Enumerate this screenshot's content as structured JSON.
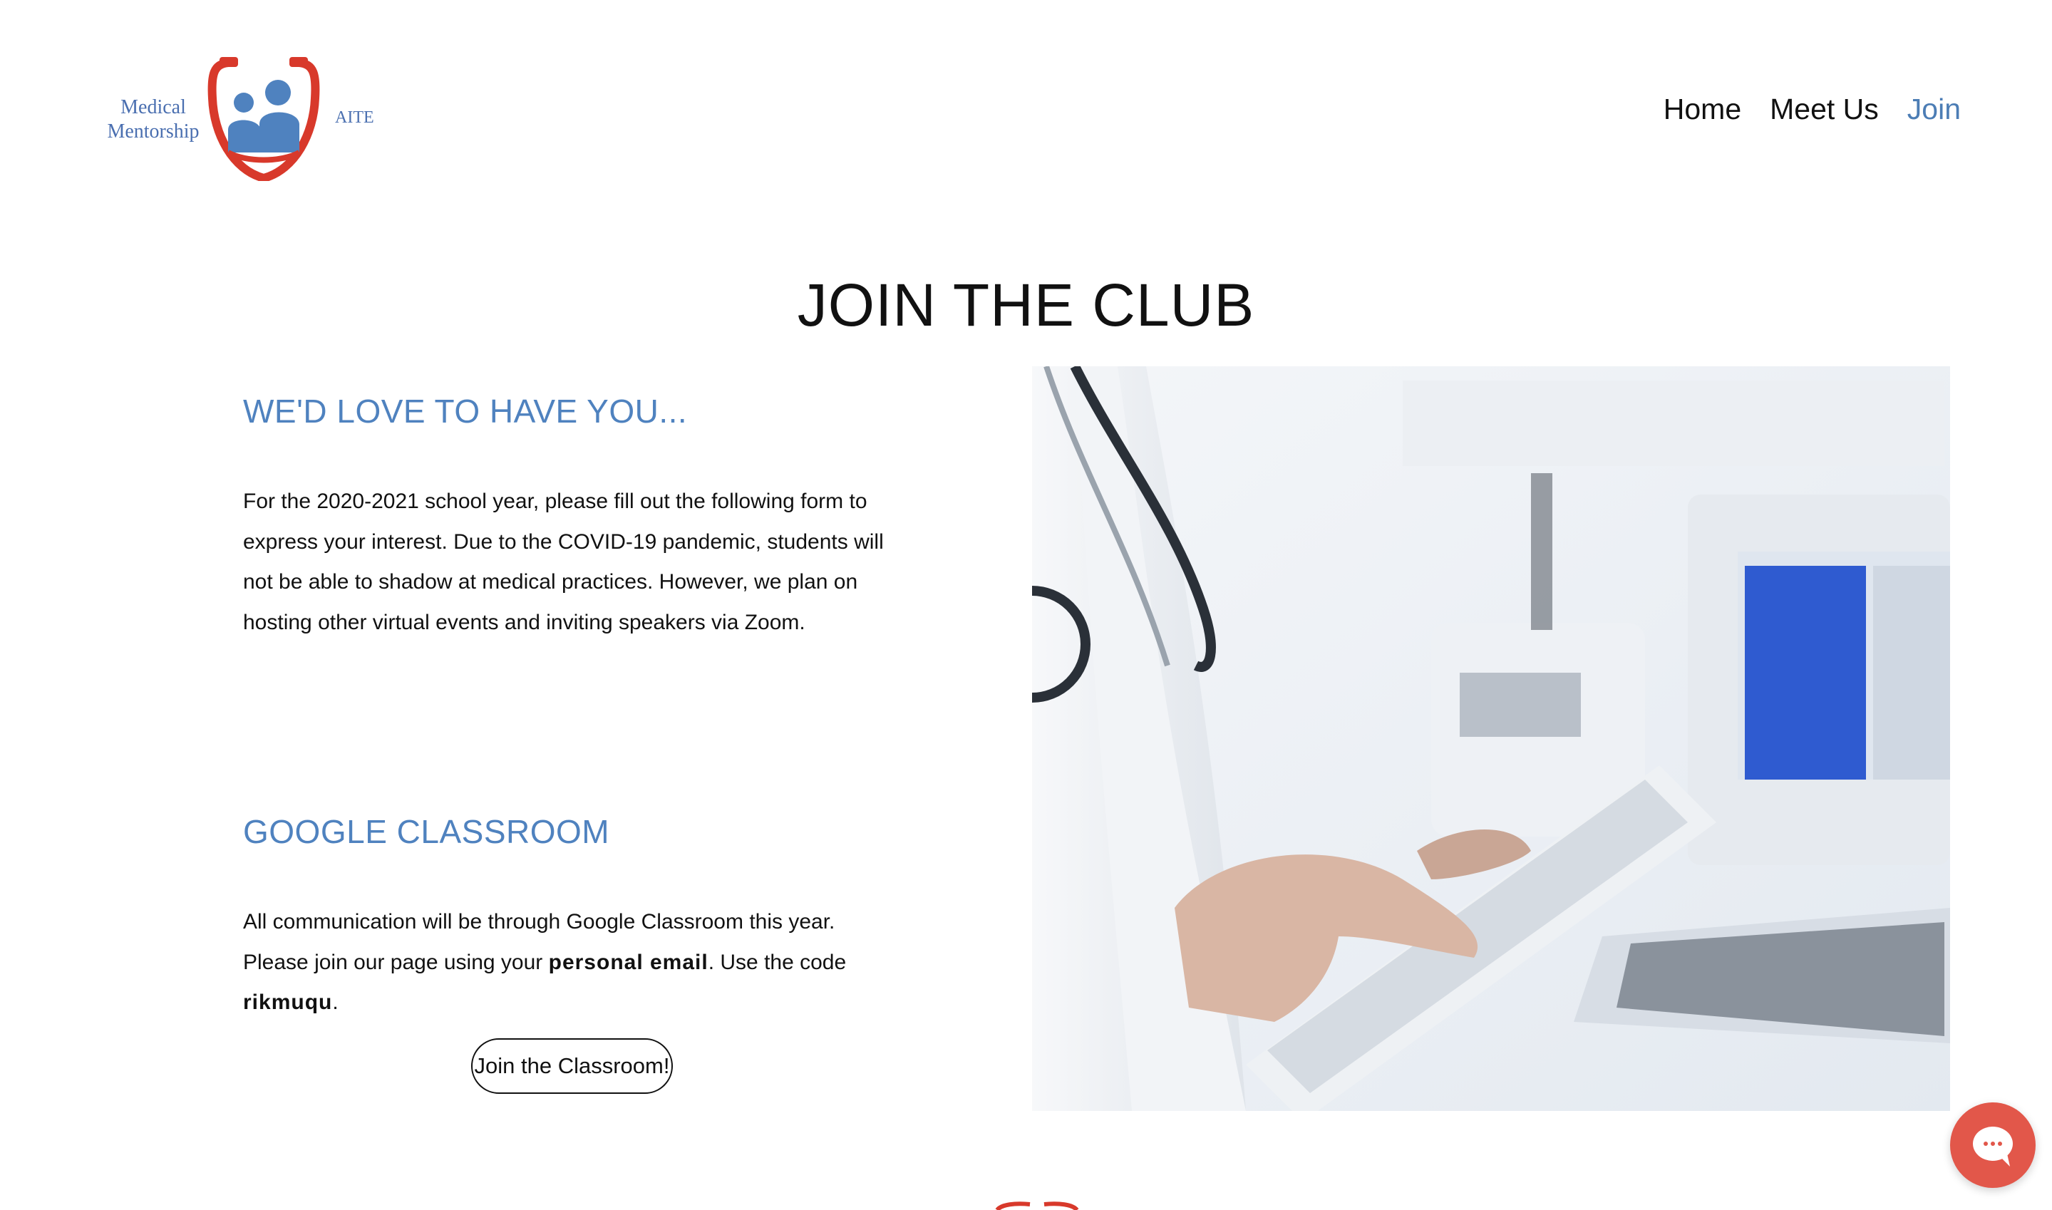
{
  "header": {
    "logo": {
      "left_text_line1": "Medical",
      "left_text_line2": "Mentorship",
      "right_text": "AITE",
      "colors": {
        "ring": "#d8392b",
        "figures": "#4f82bf",
        "text": "#4a6fb0"
      }
    },
    "nav": {
      "items": [
        {
          "label": "Home",
          "active": false
        },
        {
          "label": "Meet Us",
          "active": false
        },
        {
          "label": "Join",
          "active": true
        }
      ],
      "active_color": "#4c7db5"
    }
  },
  "main": {
    "title": "JOIN THE CLUB",
    "section1": {
      "heading": "WE'D LOVE TO HAVE YOU...",
      "body": "For the 2020-2021 school year, please fill out the following form to express your interest. Due to the COVID-19 pandemic, students will not be able to shadow at medical practices. However, we plan on hosting other virtual events and inviting speakers via Zoom."
    },
    "section2": {
      "heading": "GOOGLE CLASSROOM",
      "body_part1": "All communication will be through Google Classroom this year. Please join our page using your ",
      "body_strong1": "personal email",
      "body_part2": ". Use the code ",
      "body_strong2": "rikmuqu",
      "body_part3": ".",
      "button_label": "Join the Classroom!"
    },
    "hero_image": {
      "icon": "doctor-with-tablet-photo"
    },
    "heading_color": "#4f82bf"
  },
  "chat_widget": {
    "icon": "chat-bubble-icon",
    "color": "#e2574a"
  }
}
